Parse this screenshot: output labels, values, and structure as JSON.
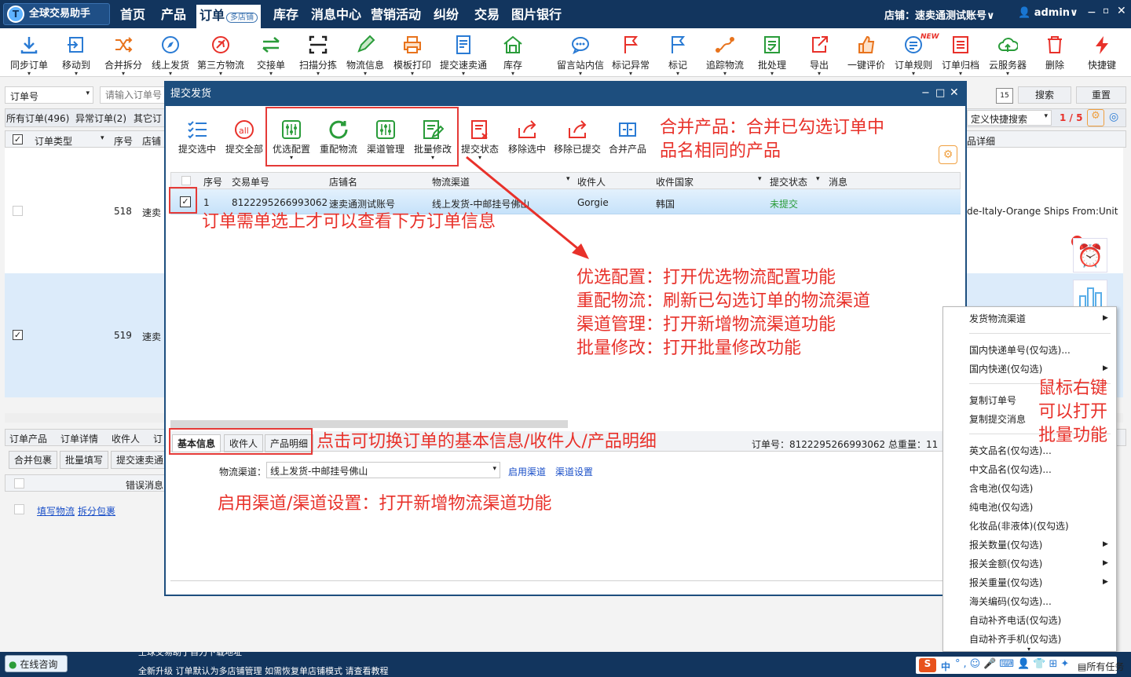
{
  "app": {
    "title": "全球交易助手"
  },
  "nav": {
    "items": [
      "首页",
      "产品",
      "订单",
      "库存",
      "消息中心",
      "营销活动",
      "纠纷",
      "交易",
      "图片银行"
    ],
    "order_badge": "多店铺"
  },
  "topright": {
    "store_label": "店铺：速卖通测试账号",
    "user": "admin",
    "chevron": "∨"
  },
  "toolbar": {
    "items": [
      "同步订单",
      "移动到",
      "合并拆分",
      "线上发货",
      "第三方物流",
      "交接单",
      "扫描分拣",
      "物流信息",
      "模板打印",
      "提交速卖通",
      "库存",
      "留言站内信",
      "标记异常",
      "标记",
      "追踪物流",
      "批处理",
      "导出",
      "一键评价",
      "订单规则",
      "订单归档",
      "云服务器",
      "删除",
      "快捷键"
    ],
    "new_badge": "NEW"
  },
  "filter": {
    "field": "订单号",
    "placeholder": "请输入订单号",
    "search": "搜索",
    "reset": "重置",
    "quicksearch": "定义快捷搜索",
    "page": "1 / 5"
  },
  "order_tabs": [
    "所有订单(496)",
    "异常订单(2)",
    "其它订"
  ],
  "main_table": {
    "headers": [
      "订单类型",
      "序号",
      "店铺"
    ],
    "detail_header": "品详细",
    "rows": [
      {
        "index": "518",
        "store": "速卖",
        "detail": "de-Italy-Orange  Ships From:Unit"
      },
      {
        "index": "519",
        "store": "速卖"
      }
    ]
  },
  "bottom_tabs": [
    "订单产品",
    "订单详情",
    "收件人",
    "订"
  ],
  "bottom_buttons": [
    "合并包裹",
    "批量填写",
    "提交速卖通"
  ],
  "error_header": "错误消息",
  "bottom_links": [
    "填写物流",
    "拆分包裹"
  ],
  "dialog": {
    "title": "提交发货",
    "win_controls": [
      "−",
      "□",
      "✕"
    ],
    "actions": [
      "提交选中",
      "提交全部",
      "优选配置",
      "重配物流",
      "渠道管理",
      "批量修改",
      "提交状态",
      "移除选中",
      "移除已提交",
      "合并产品"
    ],
    "headers": [
      "序号",
      "交易单号",
      "店铺名",
      "物流渠道",
      "收件人",
      "收件国家",
      "提交状态",
      "消息"
    ],
    "row": {
      "index": "1",
      "trade_no": "8122295266993062",
      "store": "速卖通测试账号",
      "channel": "线上发货-中邮挂号佛山",
      "recipient": "Gorgie",
      "country": "韩国",
      "status": "未提交"
    },
    "detail_tabs": [
      "基本信息",
      "收件人",
      "产品明细"
    ],
    "order_no_label": "订单号：",
    "order_no": "8122295266993062",
    "weight_label": "总重量：",
    "weight": "11",
    "channel_label": "物流渠道：",
    "channel_value": "线上发货-中邮挂号佛山",
    "enable_channel": "启用渠道",
    "channel_settings": "渠道设置"
  },
  "annotations": {
    "merge": [
      "合并产品：合并已勾选订单中",
      "品名相同的产品"
    ],
    "select": "订单需单选上才可以查看下方订单信息",
    "features": [
      "优选配置：打开优选物流配置功能",
      "重配物流：刷新已勾选订单的物流渠道",
      "渠道管理：打开新增物流渠道功能",
      "批量修改：打开批量修改功能"
    ],
    "tabs": "点击可切换订单的基本信息/收件人/产品明细",
    "channel": "启用渠道/渠道设置：打开新增物流渠道功能",
    "rightclick": [
      "鼠标右键",
      "可以打开",
      "批量功能"
    ]
  },
  "context_menu": [
    "发货物流渠道",
    "国内快递单号(仅勾选)...",
    "国内快递(仅勾选)",
    "复制订单号",
    "复制提交消息",
    "英文品名(仅勾选)...",
    "中文品名(仅勾选)...",
    "含电池(仅勾选)",
    "纯电池(仅勾选)",
    "化妆品(非液体)(仅勾选)",
    "报关数量(仅勾选)",
    "报关金额(仅勾选)",
    "报关重量(仅勾选)",
    "海关编码(仅勾选)...",
    "自动补齐电话(仅勾选)",
    "自动补齐手机(仅勾选)"
  ],
  "side_badge": "4",
  "statusbar": {
    "consult": "在线咨询",
    "ticker1": "土球交易助于自力下载地址",
    "ticker2": "全新升级    订单默认为多店铺管理    如需恢复单店铺模式    请查看教程",
    "tasks": "所有任务",
    "ime": "中",
    "sogou": "S"
  }
}
